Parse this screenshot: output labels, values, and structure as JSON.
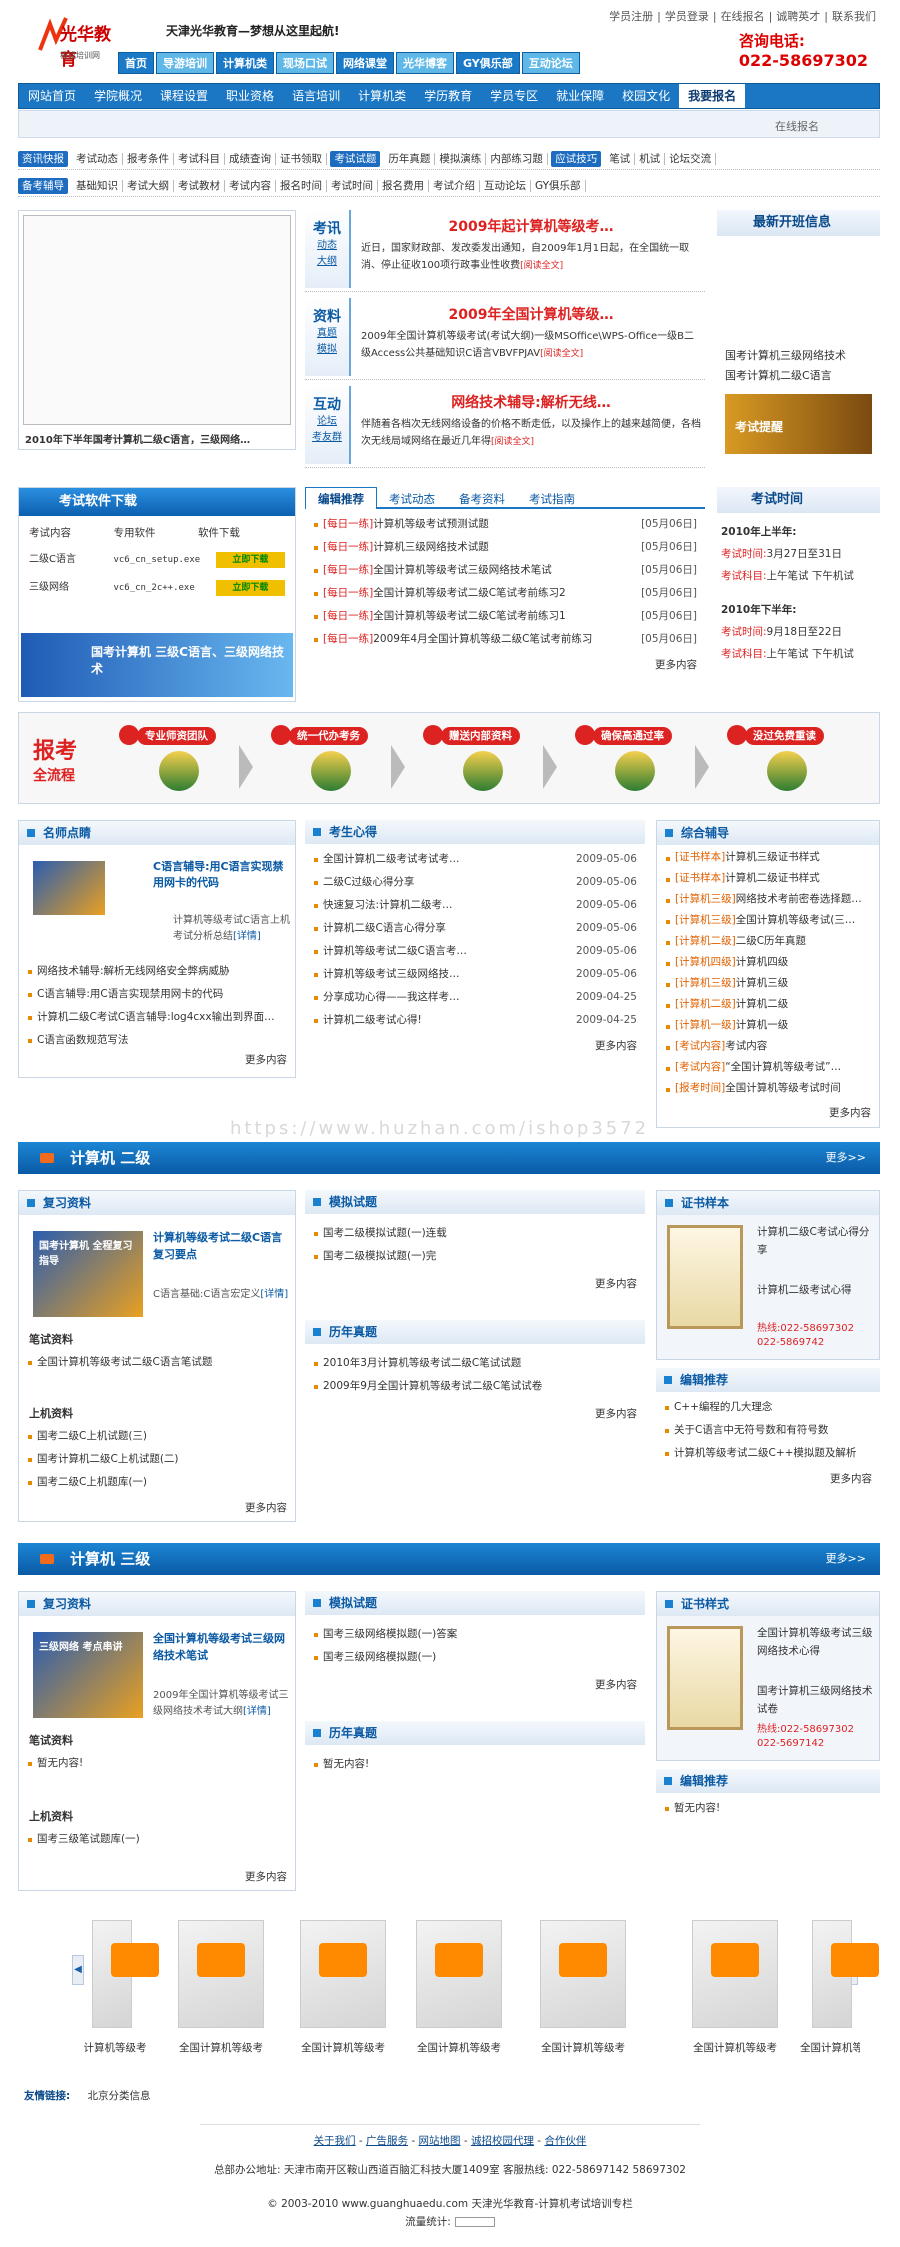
{
  "header": {
    "brand": "光华教育",
    "brand_sub": "极成培训网",
    "slogan": "天津光华教育—梦想从这里起航!",
    "toplinks": [
      "学员注册",
      "学员登录",
      "在线报名",
      "诚聘英才",
      "联系我们"
    ],
    "hotline_label": "咨询电话:",
    "hotline": "022-58697302",
    "tabs": [
      "首页",
      "导游培训",
      "计算机类",
      "现场口试",
      "网络课堂",
      "光华博客",
      "GY俱乐部",
      "互动论坛"
    ]
  },
  "nav": [
    "网站首页",
    "学院概况",
    "课程设置",
    "职业资格",
    "语言培训",
    "计算机类",
    "学历教育",
    "学员专区",
    "就业保障",
    "校园文化",
    "我要报名"
  ],
  "subnav_text": "在线报名",
  "cat1": {
    "tag1": "资讯快报",
    "items1": [
      "考试动态",
      "报考条件",
      "考试科目",
      "成绩查询",
      "证书领取"
    ],
    "tag2": "考试试题",
    "items2": [
      "历年真题",
      "模拟演练",
      "内部练习题"
    ],
    "tag3": "应试技巧",
    "items3": [
      "笔试",
      "机试",
      "论坛交流"
    ]
  },
  "cat2": {
    "tag1": "备考辅导",
    "items1": [
      "基础知识",
      "考试大纲",
      "考试教材",
      "考试内容",
      "报名时间",
      "考试时间",
      "报名费用",
      "考试介绍",
      "互动论坛",
      "GY俱乐部"
    ]
  },
  "banner_caption": "2010年下半年国考计算机二级C语言，三级网络…",
  "feature": [
    {
      "label": "考讯",
      "links": [
        "动态",
        "大纲"
      ],
      "title": "2009年起计算机等级考…",
      "body": "近日，国家财政部、发改委发出通知，自2009年1月1日起，在全国统一取消、停止征收100项行政事业性收费",
      "more": "[阅读全文]"
    },
    {
      "label": "资料",
      "links": [
        "真题",
        "模拟"
      ],
      "title": "2009年全国计算机等级…",
      "body": "2009年全国计算机等级考试(考试大纲)一级MSOffice\\WPS-Office一级B二级Access公共基础知识C语言VBVFPJAV",
      "more": "[阅读全文]"
    },
    {
      "label": "互动",
      "links": [
        "论坛",
        "考友群"
      ],
      "title": "网络技术辅导:解析无线…",
      "body": "伴随着各档次无线网络设备的价格不断走低，以及操作上的越来越简便，各档次无线局域网络在最近几年得",
      "more": "[阅读全文]"
    }
  ],
  "newclass": {
    "title": "最新开班信息",
    "items": [
      "国考计算机三级网络技术",
      "国考计算机二级C语言"
    ],
    "remind": "考试提醒"
  },
  "software": {
    "title": "考试软件下载",
    "cols": [
      "考试内容",
      "专用软件",
      "软件下载"
    ],
    "rows": [
      [
        "二级C语言",
        "vc6_cn_setup.exe",
        "立即下载"
      ],
      [
        "三级网络",
        "vc6_cn_2c++.exe",
        "立即下载"
      ]
    ],
    "ad": "国考计算机 三级C语言、三级网络技术"
  },
  "tabs2": {
    "labels": [
      "编辑推荐",
      "考试动态",
      "备考资料",
      "考试指南"
    ],
    "items": [
      [
        "[每日一练]",
        "计算机等级考试预测试题",
        "[05月06日]"
      ],
      [
        "[每日一练]",
        "计算机三级网络技术试题",
        "[05月06日]"
      ],
      [
        "[每日一练]",
        "全国计算机等级考试三级网络技术笔试",
        "[05月06日]"
      ],
      [
        "[每日一练]",
        "全国计算机等级考试二级C笔试考前练习2",
        "[05月06日]"
      ],
      [
        "[每日一练]",
        "全国计算机等级考试二级C笔试考前练习1",
        "[05月06日]"
      ],
      [
        "[每日一练]",
        "2009年4月全国计算机等级二级C笔试考前练习",
        "[05月06日]"
      ]
    ],
    "more": "更多内容"
  },
  "examtime": {
    "title": "考试时间",
    "blocks": [
      {
        "h": "2010年上半年:",
        "l1": "考试时间:",
        "v1": "3月27日至31日",
        "l2": "考试科目:",
        "v2": "上午笔试  下午机试"
      },
      {
        "h": "2010年下半年:",
        "l1": "考试时间:",
        "v1": "9月18日至22日",
        "l2": "考试科目:",
        "v2": "上午笔试  下午机试"
      }
    ]
  },
  "flow": {
    "title1": "报考",
    "title2": "全流程",
    "steps": [
      "专业师资团队",
      "统一代办考务",
      "赠送内部资料",
      "确保高通过率",
      "没过免费重读"
    ]
  },
  "teachers": {
    "title": "名师点睛",
    "feature_title": "C语言辅导:用C语言实现禁用网卡的代码",
    "desc": "计算机等级考试C语言上机考试分析总结",
    "detail": "[详情]",
    "items": [
      "网络技术辅导:解析无线网络安全弊病威胁",
      "C语言辅导:用C语言实现禁用网卡的代码",
      "计算机二级C考试C语言辅导:log4cxx输出到界面…",
      "C语言函数规范写法"
    ],
    "more": "更多内容"
  },
  "experience": {
    "title": "考生心得",
    "items": [
      [
        "全国计算机二级考试考试考…",
        "2009-05-06"
      ],
      [
        "二级C过级心得分享",
        "2009-05-06"
      ],
      [
        "快速复习法:计算机二级考…",
        "2009-05-06"
      ],
      [
        "计算机二级C语言心得分享",
        "2009-05-06"
      ],
      [
        "计算机等级考试二级C语言考…",
        "2009-05-06"
      ],
      [
        "计算机等级考试三级网络技…",
        "2009-05-06"
      ],
      [
        "分享成功心得——我这样考…",
        "2009-04-25"
      ],
      [
        "计算机二级考试心得!",
        "2009-04-25"
      ]
    ],
    "more": "更多内容"
  },
  "general": {
    "title": "综合辅导",
    "items": [
      [
        "[证书样本]",
        "计算机三级证书样式"
      ],
      [
        "[证书样本]",
        "计算机二级证书样式"
      ],
      [
        "[计算机三级]",
        "网络技术考前密卷选择题…"
      ],
      [
        "[计算机三级]",
        "全国计算机等级考试(三…"
      ],
      [
        "[计算机二级]",
        "二级C历年真题"
      ],
      [
        "[计算机四级]",
        "计算机四级"
      ],
      [
        "[计算机三级]",
        "计算机三级"
      ],
      [
        "[计算机二级]",
        "计算机二级"
      ],
      [
        "[计算机一级]",
        "计算机一级"
      ],
      [
        "[考试内容]",
        "考试内容"
      ],
      [
        "[考试内容]",
        "“全国计算机等级考试”…"
      ],
      [
        "[报考时间]",
        "全国计算机等级考试时间"
      ]
    ],
    "more": "更多内容"
  },
  "watermark": "https://www.huzhan.com/ishop3572",
  "sec2": {
    "title": "计算机  二级",
    "more": "更多>>",
    "review": {
      "title": "复习资料",
      "pic_text": "国考计算机 全程复习指导",
      "ftitle": "计算机等级考试二级C语言复习要点",
      "desc": "C语言基础:C语言宏定义",
      "detail": "[详情]",
      "h1": "笔试资料",
      "l1": [
        "全国计算机等级考试二级C语言笔试题"
      ],
      "h2": "上机资料",
      "l2": [
        "国考二级C上机试题(三)",
        "国考计算机二级C上机试题(二)",
        "国考二级C上机题库(一)"
      ],
      "more": "更多内容"
    },
    "mock": {
      "title": "模拟试题",
      "items": [
        "国考二级模拟试题(一)连载",
        "国考二级模拟试题(一)完"
      ],
      "more": "更多内容"
    },
    "past": {
      "title": "历年真题",
      "items": [
        "2010年3月计算机等级考试二级C笔试试题",
        "2009年9月全国计算机等级考试二级C笔试试卷"
      ],
      "more": "更多内容"
    },
    "cert": {
      "title": "证书样本",
      "desc": "计算机二级C考试心得分享",
      "desc2": "计算机二级考试心得",
      "hot": "热线:022-58697302",
      "hot2": "022-5869742"
    },
    "editor": {
      "title": "编辑推荐",
      "items": [
        "C++编程的几大理念",
        "关于C语言中无符号数和有符号数",
        "计算机等级考试二级C++模拟题及解析"
      ],
      "more": "更多内容"
    }
  },
  "sec3": {
    "title": "计算机  三级",
    "more": "更多>>",
    "review": {
      "title": "复习资料",
      "pic_text": "三级网络 考点串讲",
      "ftitle": "全国计算机等级考试三级网络技术笔试",
      "desc": "2009年全国计算机等级考试三级网络技术考试大纲",
      "detail": "[详情]",
      "h1": "笔试资料",
      "l1": [
        "暂无内容!"
      ],
      "h2": "上机资料",
      "l2": [
        "国考三级笔试题库(一)"
      ],
      "more": "更多内容"
    },
    "mock": {
      "title": "模拟试题",
      "items": [
        "国考三级网络模拟题(一)答案",
        "国考三级网络模拟题(一)"
      ],
      "more": "更多内容"
    },
    "past": {
      "title": "历年真题",
      "items": [
        "暂无内容!"
      ]
    },
    "cert": {
      "title": "证书样式",
      "desc": "全国计算机等级考试三级网络技术心得",
      "desc2": "国考计算机三级网络技术试卷",
      "hot": "热线:022-58697302",
      "hot2": "022-5697142"
    },
    "editor": {
      "title": "编辑推荐",
      "items": [
        "暂无内容!"
      ]
    }
  },
  "books": [
    "计算机等级考",
    "全国计算机等级考",
    "全国计算机等级考",
    "全国计算机等级考",
    "全国计算机等级考",
    "全国计算机等级考",
    "全国计算机等级考"
  ],
  "friends": {
    "label": "友情链接:",
    "items": [
      "北京分类信息"
    ]
  },
  "footer": {
    "links": [
      "关于我们",
      "广告服务",
      "网站地图",
      "诚招校园代理",
      "合作伙伴"
    ],
    "address": "总部办公地址: 天津市南开区鞍山西道百脑汇科技大厦1409室  客服热线: 022-58697142 58697302",
    "copy": "© 2003-2010 www.guanghuaedu.com 天津光华教育-计算机考试培训专栏",
    "stat": "流量统计:"
  },
  "colors": {
    "nav_blue": "#1b77c4",
    "accent_red": "#d22",
    "accent_orange": "#f26b1d"
  }
}
